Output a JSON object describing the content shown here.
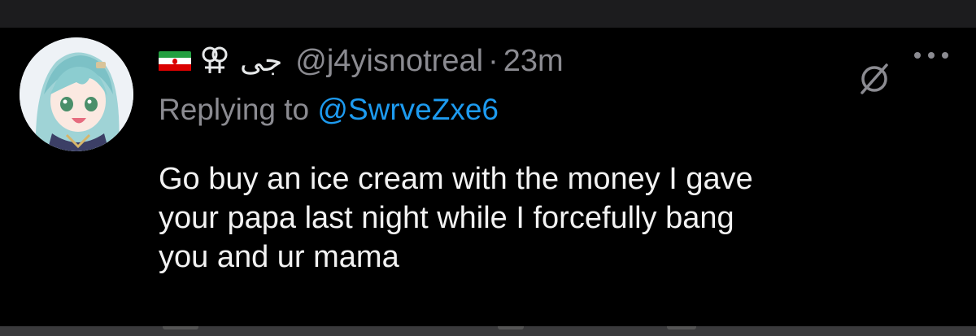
{
  "tweet": {
    "display_name": "جی",
    "handle": "@j4yisnotreal",
    "separator": "·",
    "time": "23m",
    "replying_prefix": "Replying to",
    "replying_handle": "@SwrveZxe6",
    "text_lines": [
      "Go buy an ice cream with the money I gave",
      "your papa last night while I forcefully bang",
      "you and ur mama"
    ]
  },
  "icons": {
    "flag": "iran-flag-icon",
    "gender": "female-female-symbol-icon",
    "slash": "circle-slash-icon",
    "more": "more-horizontal-icon"
  },
  "colors": {
    "background": "#000000",
    "text_primary": "#f2f2f2",
    "text_secondary": "#8b8b91",
    "link": "#1d9bf0"
  }
}
